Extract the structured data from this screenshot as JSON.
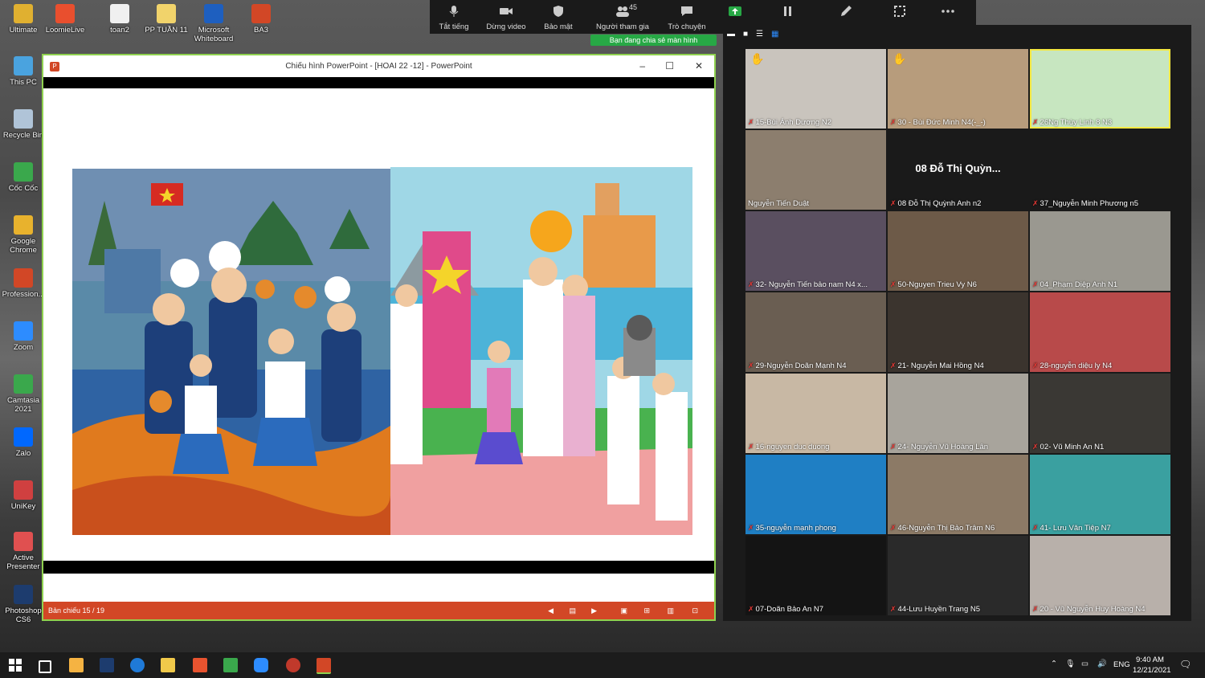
{
  "desktop_icons": [
    {
      "label": "Ultimate",
      "color": "#e0b030"
    },
    {
      "label": "LoomieLive",
      "color": "#e94f2e"
    },
    {
      "label": "toan2",
      "color": "#f0f0f0"
    },
    {
      "label": "PP TUẦN 11",
      "color": "#f1d36b"
    },
    {
      "label": "Microsoft Whiteboard",
      "color": "#1e5fbf"
    },
    {
      "label": "BA3",
      "color": "#d24726"
    },
    {
      "label": "This PC",
      "color": "#4aa3df"
    },
    {
      "label": "Recycle Bin",
      "color": "#b0c4d8"
    },
    {
      "label": "Cốc Cốc",
      "color": "#3aa84c"
    },
    {
      "label": "Google Chrome",
      "color": "#e8b22d"
    },
    {
      "label": "Profession...",
      "color": "#d24726"
    },
    {
      "label": "Zoom",
      "color": "#2d8cff"
    },
    {
      "label": "Camtasia 2021",
      "color": "#3aa84c"
    },
    {
      "label": "Zalo",
      "color": "#0068ff"
    },
    {
      "label": "UniKey",
      "color": "#d04040"
    },
    {
      "label": "Active Presenter",
      "color": "#e05050"
    },
    {
      "label": "Photoshop CS6",
      "color": "#1d3c6e"
    }
  ],
  "ppt": {
    "title": "Chiếu hình PowerPoint - [HOAI 22 -12] - PowerPoint",
    "status": "Bản chiếu 15 / 19"
  },
  "zoom_toolbar": {
    "participants_count": "45",
    "buttons": [
      {
        "label": "Tắt tiếng",
        "icon": "microphone-icon"
      },
      {
        "label": "Dừng video",
        "icon": "video-camera-icon"
      },
      {
        "label": "Bảo mật",
        "icon": "shield-icon"
      },
      {
        "label": "Người tham gia",
        "icon": "participants-icon"
      },
      {
        "label": "Trò chuyện",
        "icon": "chat-icon"
      },
      {
        "label": "",
        "icon": "share-screen-icon"
      },
      {
        "label": "",
        "icon": "pause-icon"
      },
      {
        "label": "",
        "icon": "annotate-icon"
      },
      {
        "label": "",
        "icon": "remote-control-icon"
      },
      {
        "label": "",
        "icon": "more-icon"
      }
    ],
    "sharing_notice": "Bạn đang chia sẻ màn hình"
  },
  "gallery": [
    {
      "name": "15-Bùi Ánh Dương N2",
      "bg": "#c9c4bd",
      "muted": true,
      "hand": true
    },
    {
      "name": "30 - Bùi Đức Minh N4(-_-)",
      "bg": "#b79c7c",
      "muted": true,
      "hand": true
    },
    {
      "name": "26Ng Thùy Linh 8 N3",
      "bg": "#c7e6c0",
      "muted": true,
      "active": true
    },
    {
      "name": "Nguyễn Tiến Duật",
      "bg": "#8c7e6e",
      "muted": false
    },
    {
      "name": "08 Đỗ Thị Quỳnh Anh n2",
      "bg": "#1a1a1a",
      "muted": true,
      "big": "08 Đỗ Thị Quỳn..."
    },
    {
      "name": "37_Nguyễn Minh Phương n5",
      "bg": "#1a1a1a",
      "muted": true
    },
    {
      "name": "32- Nguyễn Tiến bảo nam  N4 x...",
      "bg": "#5a4f60",
      "muted": true
    },
    {
      "name": "50-Nguyen Trieu Vy N6",
      "bg": "#6d5a48",
      "muted": true
    },
    {
      "name": "04_Phạm Diệp Anh N1",
      "bg": "#9a9890",
      "muted": true
    },
    {
      "name": "29-Nguyễn Doãn Mạnh N4",
      "bg": "#6a5e52",
      "muted": true
    },
    {
      "name": "21- Nguyễn Mai Hồng N4",
      "bg": "#3b342e",
      "muted": true
    },
    {
      "name": "28-nguyễn diệu ly N4",
      "bg": "#b84a4a",
      "muted": true
    },
    {
      "name": "16-nguyen duc duong",
      "bg": "#c8b8a4",
      "muted": true
    },
    {
      "name": "24- Nguyễn Vũ Hoàng Lân",
      "bg": "#a8a49c",
      "muted": true
    },
    {
      "name": "02- Vũ Minh An N1",
      "bg": "#3a3834",
      "muted": true
    },
    {
      "name": "35-nguyễn mạnh phong",
      "bg": "#1f7fc4",
      "muted": true
    },
    {
      "name": "46-Nguyễn Thị Bảo Trâm N6",
      "bg": "#8c7a66",
      "muted": true
    },
    {
      "name": "41- Lưu Văn Tiệp N7",
      "bg": "#3aa0a0",
      "muted": true
    },
    {
      "name": "07-Doãn Bảo An N7",
      "bg": "#141414",
      "muted": true
    },
    {
      "name": "44-Lưu Huyền Trang N5",
      "bg": "#2a2a2a",
      "muted": true
    },
    {
      "name": "20 - Vũ Nguyễn Huy Hoàng N4",
      "bg": "#b8b0aa",
      "muted": true
    }
  ],
  "taskbar": {
    "time": "9:40 AM",
    "date": "12/21/2021",
    "lang": "ENG"
  }
}
